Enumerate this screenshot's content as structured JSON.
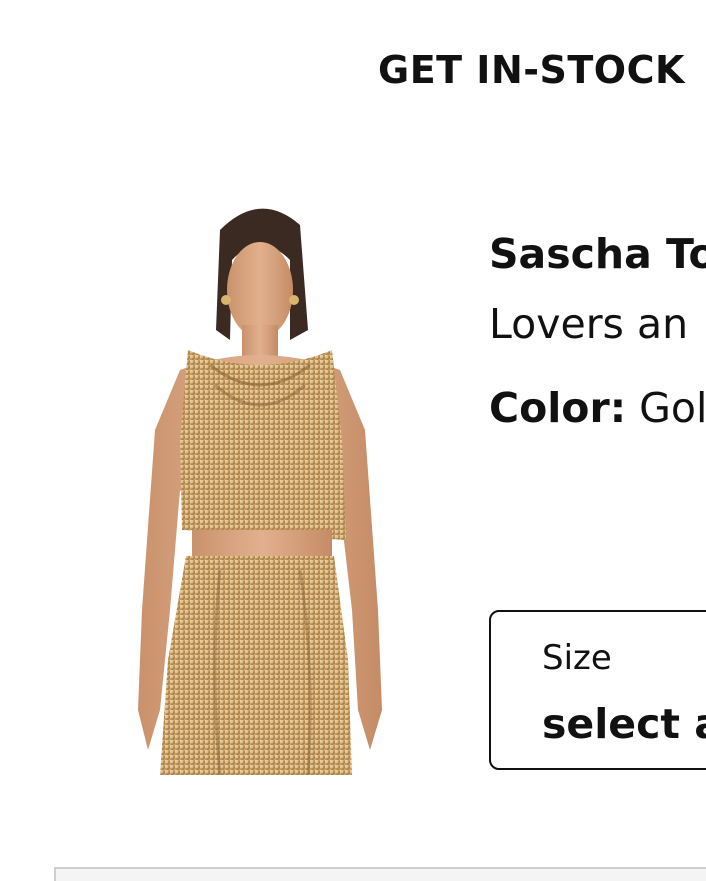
{
  "header": {
    "title": "GET IN-STOCK"
  },
  "product": {
    "image_alt": "Model wearing gold metal mesh cowl neck crop top and matching skirt",
    "name": "Sascha To",
    "subtitle": "Lovers an",
    "color_label": "Color:",
    "color_value": "Gol"
  },
  "size_select": {
    "label": "Size",
    "value": "select a"
  },
  "colors": {
    "text": "#111111",
    "gold": "#c9a36a"
  }
}
